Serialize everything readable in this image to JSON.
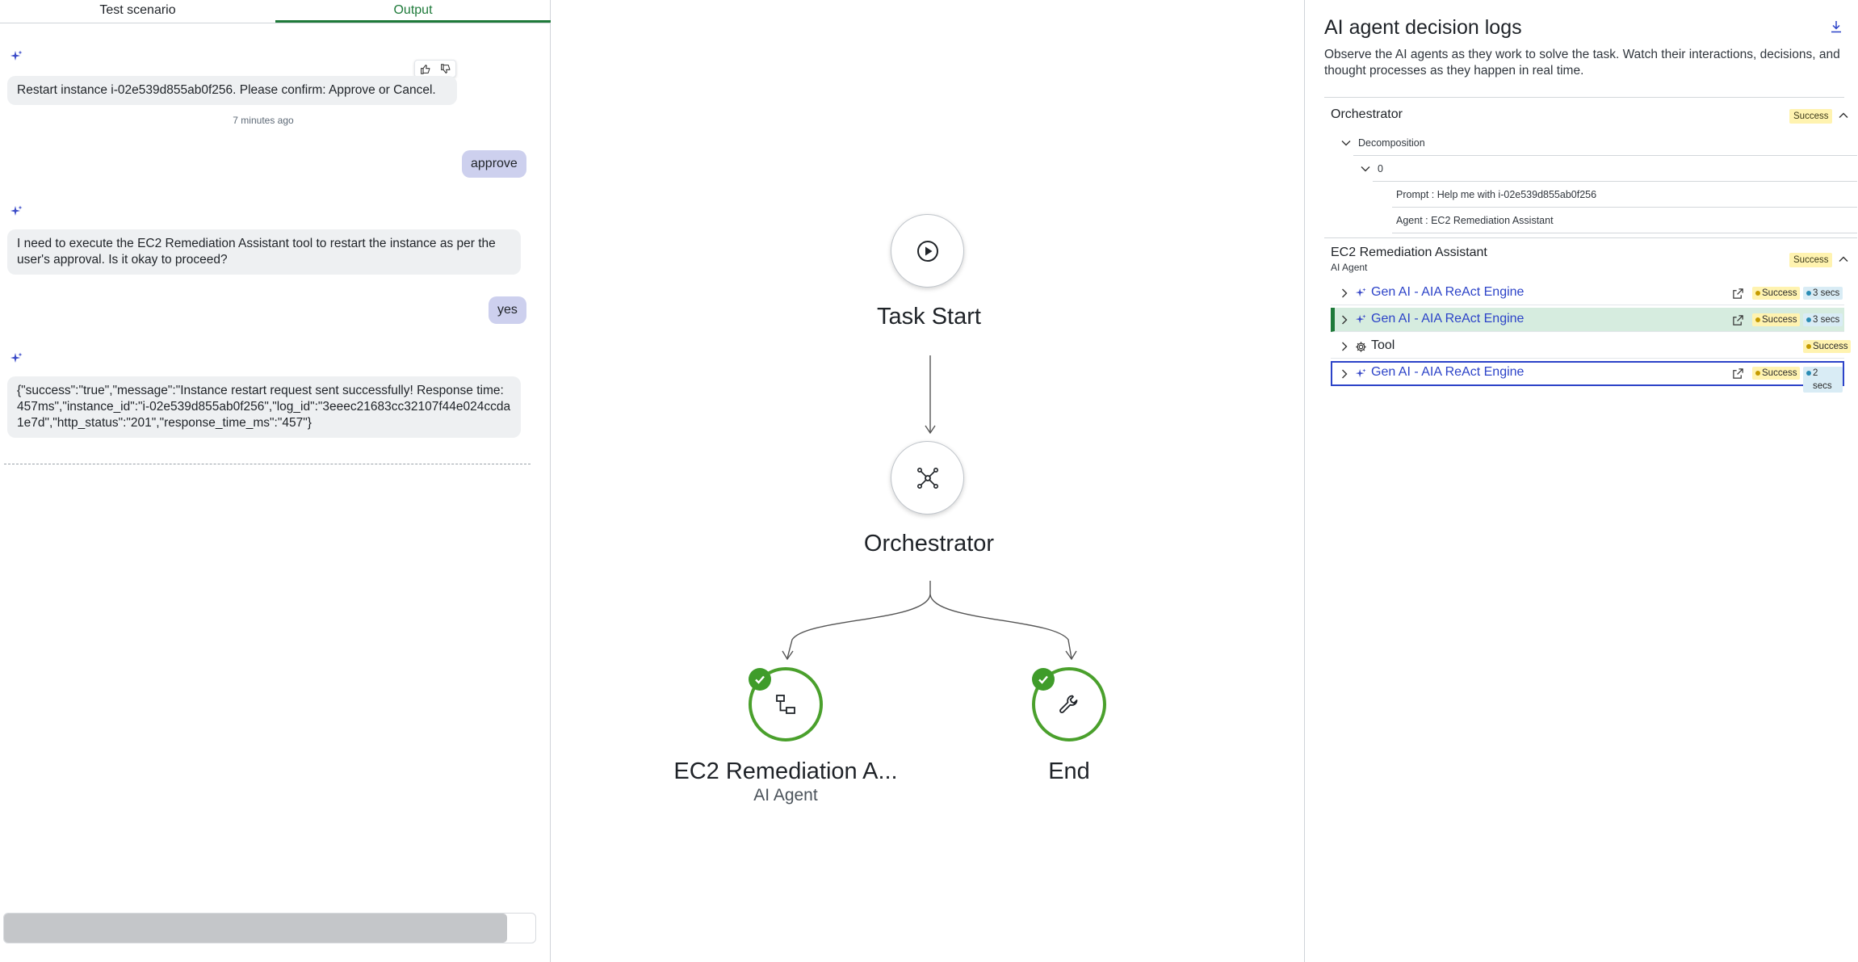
{
  "tabs": [
    {
      "label": "Test scenario",
      "active": false
    },
    {
      "label": "Output",
      "active": true
    }
  ],
  "chat": {
    "messages": [
      {
        "role": "ai",
        "text": "Restart instance i-02e539d855ab0f256. Please confirm: Approve or Cancel."
      },
      {
        "role": "user",
        "text": "approve"
      },
      {
        "role": "ai",
        "text": "I need to execute the EC2 Remediation Assistant tool to restart the instance as per the user's approval. Is it okay to proceed?"
      },
      {
        "role": "user",
        "text": "yes"
      },
      {
        "role": "ai",
        "text": "{\"success\":\"true\",\"message\":\"Instance restart request sent successfully! Response time: 457ms\",\"instance_id\":\"i-02e539d855ab0f256\",\"log_id\":\"3eeec21683cc32107f44e024ccda1e7d\",\"http_status\":\"201\",\"response_time_ms\":\"457\"}"
      }
    ],
    "timestamp": "7 minutes ago",
    "input_value": ""
  },
  "flow": {
    "nodes": [
      {
        "label": "Task Start",
        "icon": "play-icon"
      },
      {
        "label": "Orchestrator",
        "icon": "network-icon"
      },
      {
        "label": "EC2 Remediation A...",
        "sublabel": "AI Agent",
        "icon": "hierarchy-icon",
        "status": "complete"
      },
      {
        "label": "End",
        "icon": "wrench-icon",
        "status": "complete"
      }
    ]
  },
  "logs": {
    "title": "AI agent decision logs",
    "description": "Observe the AI agents as they work to solve the task. Watch their interactions, decisions, and thought processes as they happen in real time.",
    "sections": [
      {
        "title": "Orchestrator",
        "status": "Success",
        "decomposition": {
          "label": "Decomposition",
          "index": "0",
          "prompt": "Prompt : Help me with i-02e539d855ab0f256",
          "agent": "Agent : EC2 Remediation Assistant"
        }
      },
      {
        "title": "EC2 Remediation Assistant",
        "subtitle": "AI Agent",
        "status": "Success",
        "rows": [
          {
            "label": "Gen AI - AIA ReAct Engine",
            "icon": "sparkle-icon",
            "status": "Success",
            "duration": "3 secs",
            "state": "normal"
          },
          {
            "label": "Gen AI - AIA ReAct Engine",
            "icon": "sparkle-icon",
            "status": "Success",
            "duration": "3 secs",
            "state": "highlighted"
          },
          {
            "label": "Tool",
            "icon": "gear-icon",
            "status": "Success",
            "duration": "",
            "state": "normal"
          },
          {
            "label": "Gen AI - AIA ReAct Engine",
            "icon": "sparkle-icon",
            "status": "Success",
            "duration": "2 secs",
            "state": "selected"
          }
        ]
      }
    ]
  },
  "colors": {
    "accent_green": "#1e7a3a",
    "node_green": "#4aa02c",
    "link_blue": "#2c43c8",
    "user_bubble": "#cdd0ee",
    "success_badge": "#fff3b0"
  }
}
